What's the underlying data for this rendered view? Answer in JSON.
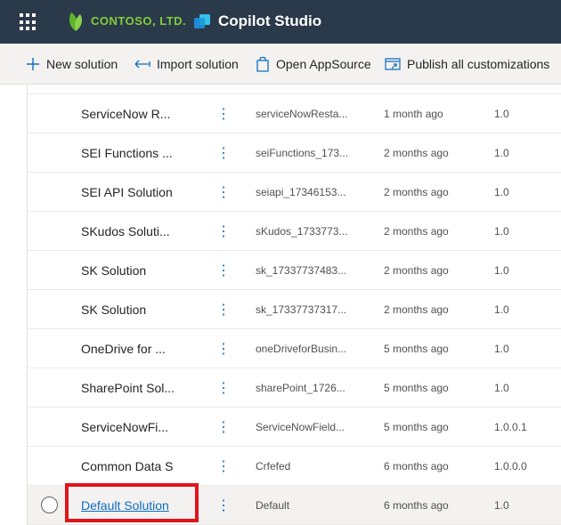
{
  "header": {
    "org_name": "CONTOSO, LTD.",
    "app_title": "Copilot Studio",
    "icons": [
      "waffle-icon",
      "contoso-leaf-logo",
      "copilot-studio-logo"
    ]
  },
  "commands": {
    "new_solution": "New solution",
    "import_solution": "Import solution",
    "open_appsource": "Open AppSource",
    "publish_all": "Publish all customizations"
  },
  "rows": [
    {
      "name": "ServiceNow R...",
      "unique_name": "serviceNowResta...",
      "modified": "1 month ago",
      "version": "1.0"
    },
    {
      "name": "SEI Functions ...",
      "unique_name": "seiFunctions_173...",
      "modified": "2 months ago",
      "version": "1.0"
    },
    {
      "name": "SEI API Solution",
      "unique_name": "seiapi_17346153...",
      "modified": "2 months ago",
      "version": "1.0"
    },
    {
      "name": "SKudos Soluti...",
      "unique_name": "sKudos_1733773...",
      "modified": "2 months ago",
      "version": "1.0"
    },
    {
      "name": "SK Solution",
      "unique_name": "sk_17337737483...",
      "modified": "2 months ago",
      "version": "1.0"
    },
    {
      "name": "SK Solution",
      "unique_name": "sk_17337737317...",
      "modified": "2 months ago",
      "version": "1.0"
    },
    {
      "name": "OneDrive for ...",
      "unique_name": "oneDriveforBusin...",
      "modified": "5 months ago",
      "version": "1.0"
    },
    {
      "name": "SharePoint Sol...",
      "unique_name": "sharePoint_1726...",
      "modified": "5 months ago",
      "version": "1.0"
    },
    {
      "name": "ServiceNowFi...",
      "unique_name": "ServiceNowField...",
      "modified": "5 months ago",
      "version": "1.0.0.1"
    },
    {
      "name": "Common Data S",
      "unique_name": "Crfefed",
      "modified": "6 months ago",
      "version": "1.0.0.0"
    },
    {
      "name": "Default Solution",
      "unique_name": "Default",
      "modified": "6 months ago",
      "version": "1.0"
    }
  ],
  "more_glyph": "⋮",
  "colors": {
    "topbar": "#2b3a4a",
    "accent": "#0f6cbd",
    "highlight": "#e0151b",
    "brand_green": "#7fcf3a"
  }
}
